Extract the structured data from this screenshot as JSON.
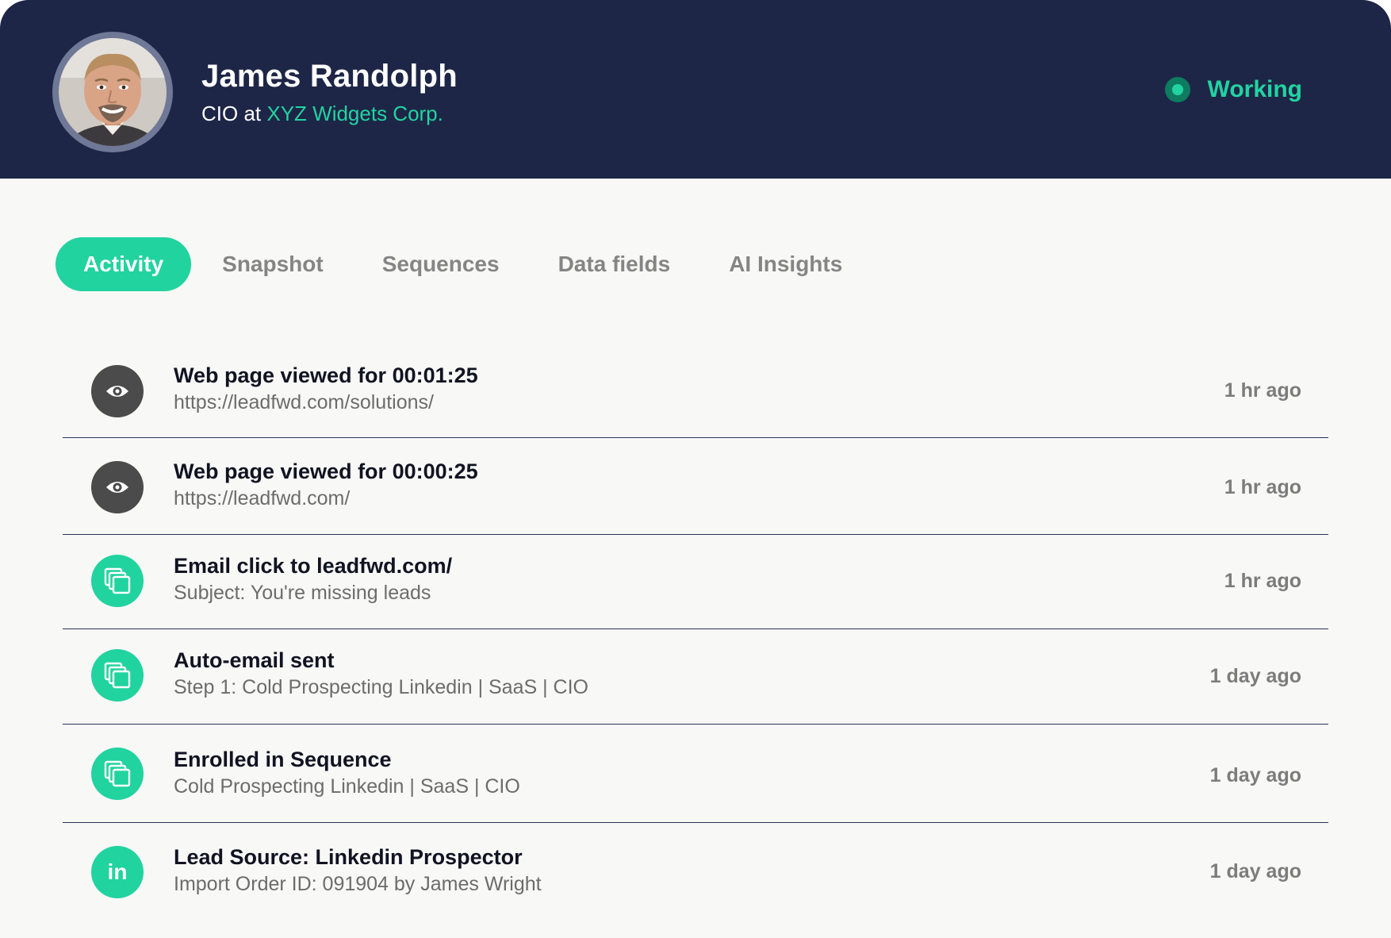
{
  "profile": {
    "name": "James Randolph",
    "role_prefix": "CIO at ",
    "company": "XYZ Widgets Corp.",
    "status": "Working",
    "avatar_icon": "user-photo"
  },
  "colors": {
    "header_bg": "#1d2647",
    "accent": "#21d39f",
    "page_bg": "#f8f8f7",
    "icon_dark": "#4b4b4b"
  },
  "tabs": [
    {
      "label": "Activity",
      "active": true
    },
    {
      "label": "Snapshot",
      "active": false
    },
    {
      "label": "Sequences",
      "active": false
    },
    {
      "label": "Data fields",
      "active": false
    },
    {
      "label": "AI Insights",
      "active": false
    }
  ],
  "activity": [
    {
      "icon": "eye-icon",
      "title": "Web page viewed for 00:01:25",
      "subtitle": "https://leadfwd.com/solutions/",
      "time": "1 hr ago"
    },
    {
      "icon": "eye-icon",
      "title": "Web page viewed for 00:00:25",
      "subtitle": "https://leadfwd.com/",
      "time": "1 hr ago"
    },
    {
      "icon": "copy-icon",
      "title": "Email click to leadfwd.com/",
      "subtitle": "Subject: You're missing leads",
      "time": "1 hr ago"
    },
    {
      "icon": "copy-icon",
      "title": "Auto-email sent",
      "subtitle": "Step 1: Cold Prospecting Linkedin | SaaS | CIO",
      "time": "1 day ago"
    },
    {
      "icon": "copy-icon",
      "title": "Enrolled in Sequence",
      "subtitle": "Cold Prospecting Linkedin | SaaS | CIO",
      "time": "1 day ago"
    },
    {
      "icon": "linkedin-icon",
      "icon_text": "in",
      "title": "Lead Source: Linkedin Prospector",
      "subtitle": "Import Order ID: 091904 by James Wright",
      "time": "1 day ago"
    }
  ]
}
